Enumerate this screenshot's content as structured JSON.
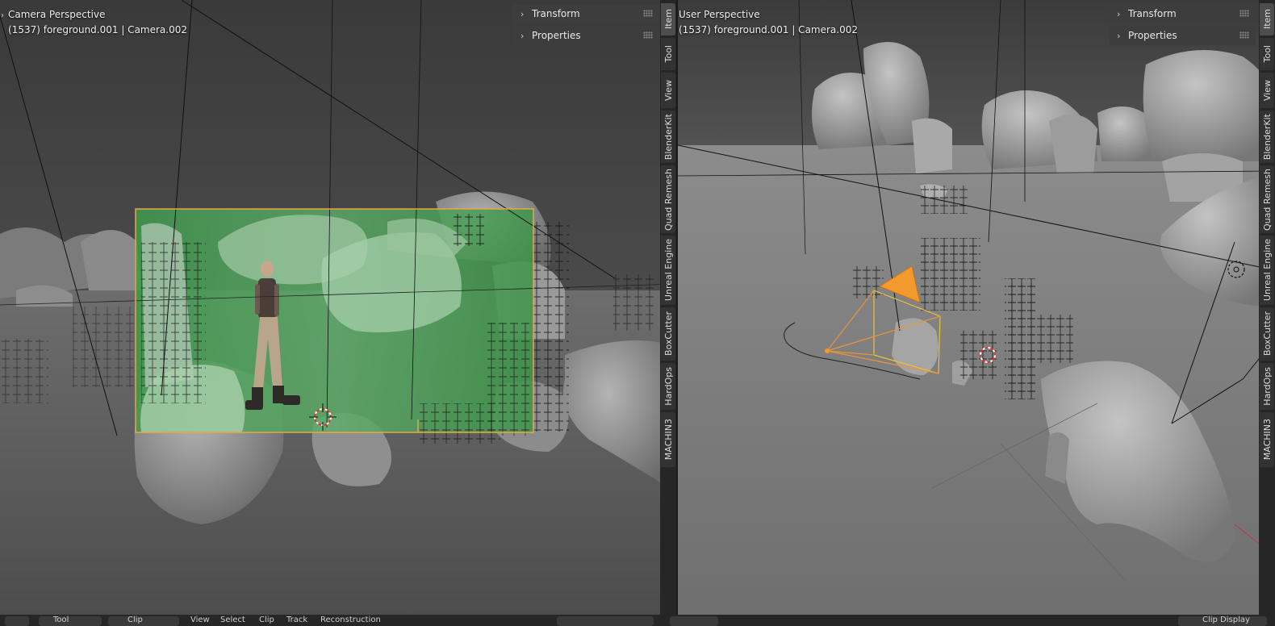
{
  "left_viewport": {
    "title": "Camera Perspective",
    "subtitle": "(1537) foreground.001 | Camera.002",
    "panels": [
      {
        "label": "Transform"
      },
      {
        "label": "Properties"
      }
    ]
  },
  "right_viewport": {
    "title": "User Perspective",
    "subtitle": "(1537) foreground.001 | Camera.002",
    "panels": [
      {
        "label": "Transform"
      },
      {
        "label": "Properties"
      }
    ]
  },
  "sidebar_tabs": [
    "Item",
    "Tool",
    "View",
    "BlenderKit",
    "Quad Remesh",
    "Unreal Engine",
    "BoxCutter",
    "HardOps",
    "MACHIN3"
  ],
  "colors": {
    "camera_frame": "#e8a54a",
    "green_screen": "#5fa86a",
    "camera_gizmo": "#f29a2e",
    "rock": "#8f8f8f",
    "tab_active": "#4d4d4d"
  },
  "bottom_bar": {
    "items": [
      "Tool",
      "Clip",
      "View",
      "Select",
      "Clip",
      "Track",
      "Reconstruction",
      "Clip Display"
    ]
  }
}
